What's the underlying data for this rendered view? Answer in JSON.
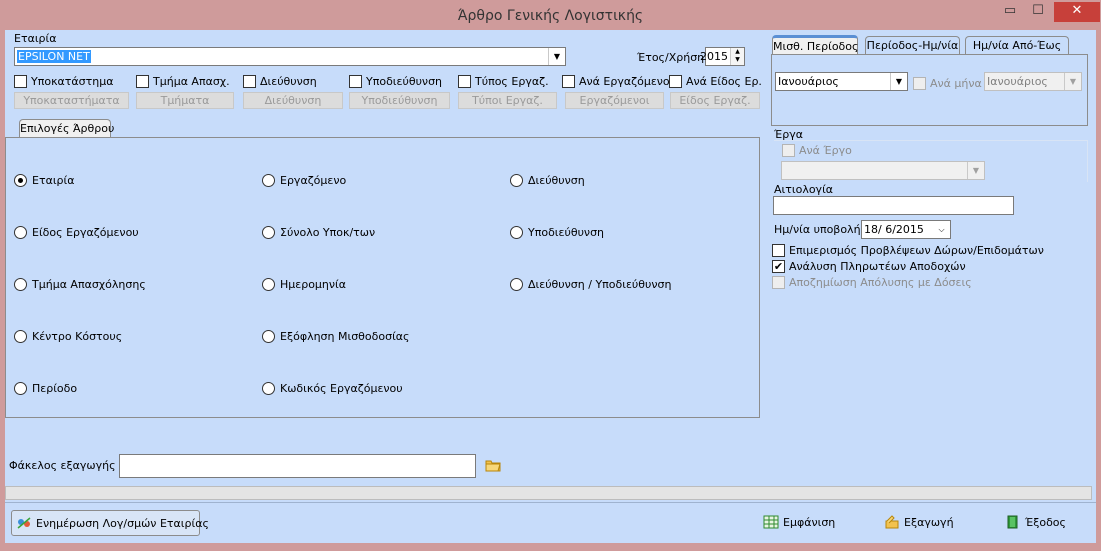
{
  "window": {
    "title": "Άρθρο Γενικής Λογιστικής",
    "controls": {
      "minimize": "▭",
      "maximize": "☐",
      "close": "✕"
    }
  },
  "company": {
    "label": "Εταιρία",
    "value": "EPSILON NET"
  },
  "year": {
    "label": "Έτος/Χρήση",
    "value": "2015"
  },
  "filters": [
    {
      "label": "Υποκατάστημα",
      "button": "Υποκαταστήματα"
    },
    {
      "label": "Τμήμα Απασχ.",
      "button": "Τμήματα"
    },
    {
      "label": "Διεύθυνση",
      "button": "Διεύθυνση"
    },
    {
      "label": "Υποδιεύθυνση",
      "button": "Υποδιεύθυνση"
    },
    {
      "label": "Τύπος Εργαζ.",
      "button": "Τύποι Εργαζ."
    },
    {
      "label": "Ανά Εργαζόμενο",
      "button": "Εργαζόμενοι"
    },
    {
      "label": "Ανά Είδος Ερ.",
      "button": "Είδος Εργαζ."
    }
  ],
  "options_tab": {
    "label": "Επιλογές Άρθρου"
  },
  "radios": [
    {
      "label": "Εταιρία",
      "checked": true
    },
    {
      "label": "Εργαζόμενο",
      "checked": false
    },
    {
      "label": "Διεύθυνση",
      "checked": false
    },
    {
      "label": "Είδος Εργαζόμενου",
      "checked": false
    },
    {
      "label": "Σύνολο Υποκ/των",
      "checked": false
    },
    {
      "label": "Υποδιεύθυνση",
      "checked": false
    },
    {
      "label": "Τμήμα Απασχόλησης",
      "checked": false
    },
    {
      "label": "Ημερομηνία",
      "checked": false
    },
    {
      "label": "Διεύθυνση / Υποδιεύθυνση",
      "checked": false
    },
    {
      "label": "Κέντρο Κόστους",
      "checked": false
    },
    {
      "label": "Εξόφληση Μισθοδοσίας",
      "checked": false
    },
    {
      "label": "Περίοδο",
      "checked": false
    },
    {
      "label": "Κωδικός Εργαζόμενου",
      "checked": false
    }
  ],
  "period_tabs": [
    "Μισθ. Περίοδος",
    "Περίοδος-Ημ/νία",
    "Ημ/νία Από-Έως"
  ],
  "period": {
    "month": "Ιανουάριος",
    "per_month_label": "Ανά μήνα",
    "month2": "Ιανουάριος"
  },
  "projects": {
    "label": "Έργα",
    "per_project_label": "Ανά Έργο",
    "value": ""
  },
  "reason": {
    "label": "Αιτιολογία",
    "value": ""
  },
  "submit_date": {
    "label": "Ημ/νία υποβολής",
    "value": "18/  6/2015"
  },
  "options_checks": [
    {
      "label": "Επιμερισμός Προβλέψεων Δώρων/Επιδομάτων",
      "checked": false,
      "disabled": false
    },
    {
      "label": "Ανάλυση Πληρωτέων Αποδοχών",
      "checked": true,
      "disabled": false
    },
    {
      "label": "Αποζημίωση Απόλυσης με Δόσεις",
      "checked": false,
      "disabled": true
    }
  ],
  "export_folder": {
    "label": "Φάκελος εξαγωγής",
    "value": ""
  },
  "bottom_buttons": {
    "update": "Ενημέρωση Λογ/σμών Εταιρίας",
    "show": "Εμφάνιση",
    "export": "Εξαγωγή",
    "exit": "Έξοδος"
  },
  "colors": {
    "background": "#c7dcfa",
    "titlebar": "#cf9b9b",
    "selection": "#3399ff",
    "close": "#c7403a"
  }
}
